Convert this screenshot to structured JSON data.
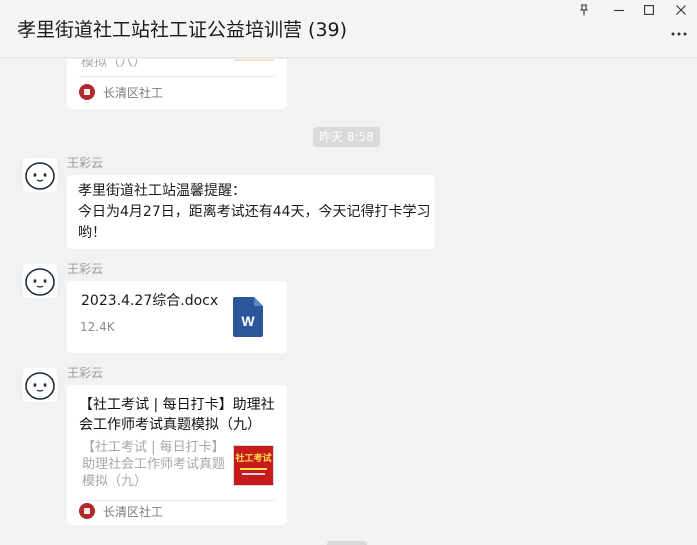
{
  "window": {
    "title": "孝里街道社工站社工证公益培训营 (39)",
    "controls": {
      "pin": "pin-icon",
      "minimize": "minimize-icon",
      "maximize": "maximize-icon",
      "close": "close-icon",
      "more": "more-icon"
    }
  },
  "messages": {
    "top_card": {
      "desc_tail": "模拟（八）",
      "source": "长清区社工"
    },
    "timestamp": "昨天 8:58",
    "msg1": {
      "sender": "王彩云",
      "line1": "孝里街道社工站温馨提醒：",
      "line2": "今日为4月27日，距离考试还有44天，今天记得打卡学习",
      "line3": "哟！"
    },
    "msg2": {
      "sender": "王彩云",
      "file_name": "2023.4.27综合.docx",
      "file_size": "12.4K",
      "file_icon_letter": "W"
    },
    "msg3": {
      "sender": "王彩云",
      "title_line1": "【社工考试 | 每日打卡】助理社",
      "title_line2": "会工作师考试真题模拟（九）",
      "desc_line1": "【社工考试 | 每日打卡】",
      "desc_line2": "助理社会工作师考试真题",
      "desc_line3": "模拟（九）",
      "thumb_text": "社工考试",
      "source": "长清区社工"
    }
  },
  "colors": {
    "word_blue": "#2b579a",
    "thumb_red": "#c8191d",
    "source_logo": "#b3282d"
  }
}
